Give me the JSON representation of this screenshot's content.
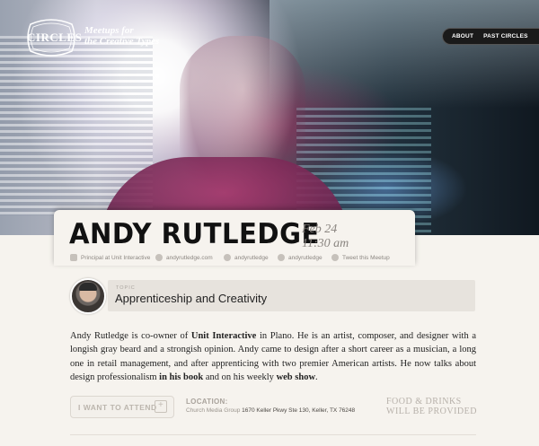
{
  "brand": {
    "logo_text": "CIRCLES",
    "tagline_line1": "Meetups for",
    "tagline_line2": "the Creative Types"
  },
  "nav": {
    "items": [
      {
        "label": "ABOUT"
      },
      {
        "label": "PAST CIRCLES"
      }
    ]
  },
  "speaker": {
    "name": "ANDY RUTLEDGE",
    "date": "Feb 24",
    "time": "11:30 am"
  },
  "meta": {
    "role": "Principal at Unit Interactive",
    "website": "andyrutledge.com",
    "handle1": "andyrutledge",
    "handle2": "andyrutledge",
    "tweet": "Tweet this Meetup"
  },
  "topic": {
    "label": "TOPIC",
    "title": "Apprenticeship and Creativity"
  },
  "description": {
    "p1": "Andy Rutledge is co-owner of ",
    "company": "Unit Interactive",
    "p2": " in Plano. He is an artist, composer, and designer with a longish gray beard and a strongish opinion. Andy came to design after a short career as a musician, a long one in retail management, and after apprenticing with two premier American artists. He now talks about design professionalism ",
    "book_link": "in his book",
    "p3": " and on his weekly ",
    "show_link": "web show",
    "p4": "."
  },
  "attend": {
    "button_label": "I WANT TO ATTEND"
  },
  "location": {
    "label": "LOCATION:",
    "venue": "Church Media Group",
    "address": "1670 Keller Pkwy Ste 130, Keller, TX 76248"
  },
  "food": {
    "line1": "FOOD & DRINKS",
    "line2": "WILL BE PROVIDED"
  }
}
